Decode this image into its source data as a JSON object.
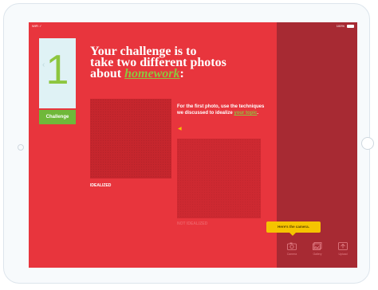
{
  "status_bar": {
    "left": "WiFi ✓",
    "battery": "100%"
  },
  "challenge_card": {
    "number": "1",
    "label": "Challenge",
    "prev_icon": "chevron-left-icon"
  },
  "headline": {
    "line1": "Your challenge is to",
    "line2": "take two different photos",
    "line3_prefix": "about ",
    "keyword": "homework",
    "line3_suffix": ":"
  },
  "photos": {
    "photo1_caption": "IDEALIZED",
    "photo2_caption": "NOT IDEALIZED"
  },
  "instruction": {
    "text": "For the first photo, use the techniques we discussed to idealize ",
    "link": "your topic",
    "suffix": "."
  },
  "tooltip": {
    "text": "Here's the camera."
  },
  "toolbar": {
    "camera_label": "Camera",
    "gallery_label": "Gallery",
    "upload_label": "Upload"
  },
  "colors": {
    "background": "#e8353d",
    "panel": "#a72a33",
    "accent_green": "#8dc63f",
    "tooltip": "#f5c400"
  }
}
